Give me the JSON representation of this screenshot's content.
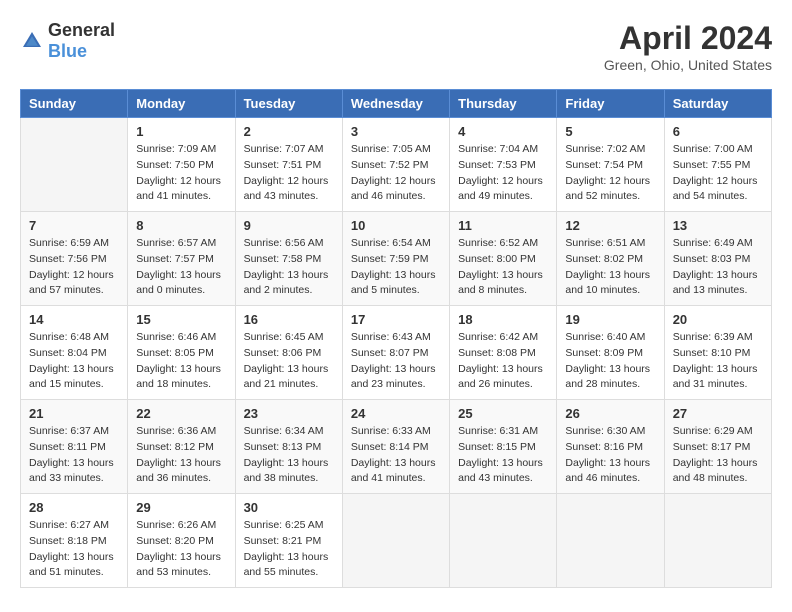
{
  "header": {
    "logo_general": "General",
    "logo_blue": "Blue",
    "title": "April 2024",
    "location": "Green, Ohio, United States"
  },
  "columns": [
    "Sunday",
    "Monday",
    "Tuesday",
    "Wednesday",
    "Thursday",
    "Friday",
    "Saturday"
  ],
  "weeks": [
    [
      {
        "day": "",
        "sunrise": "",
        "sunset": "",
        "daylight": ""
      },
      {
        "day": "1",
        "sunrise": "Sunrise: 7:09 AM",
        "sunset": "Sunset: 7:50 PM",
        "daylight": "Daylight: 12 hours and 41 minutes."
      },
      {
        "day": "2",
        "sunrise": "Sunrise: 7:07 AM",
        "sunset": "Sunset: 7:51 PM",
        "daylight": "Daylight: 12 hours and 43 minutes."
      },
      {
        "day": "3",
        "sunrise": "Sunrise: 7:05 AM",
        "sunset": "Sunset: 7:52 PM",
        "daylight": "Daylight: 12 hours and 46 minutes."
      },
      {
        "day": "4",
        "sunrise": "Sunrise: 7:04 AM",
        "sunset": "Sunset: 7:53 PM",
        "daylight": "Daylight: 12 hours and 49 minutes."
      },
      {
        "day": "5",
        "sunrise": "Sunrise: 7:02 AM",
        "sunset": "Sunset: 7:54 PM",
        "daylight": "Daylight: 12 hours and 52 minutes."
      },
      {
        "day": "6",
        "sunrise": "Sunrise: 7:00 AM",
        "sunset": "Sunset: 7:55 PM",
        "daylight": "Daylight: 12 hours and 54 minutes."
      }
    ],
    [
      {
        "day": "7",
        "sunrise": "Sunrise: 6:59 AM",
        "sunset": "Sunset: 7:56 PM",
        "daylight": "Daylight: 12 hours and 57 minutes."
      },
      {
        "day": "8",
        "sunrise": "Sunrise: 6:57 AM",
        "sunset": "Sunset: 7:57 PM",
        "daylight": "Daylight: 13 hours and 0 minutes."
      },
      {
        "day": "9",
        "sunrise": "Sunrise: 6:56 AM",
        "sunset": "Sunset: 7:58 PM",
        "daylight": "Daylight: 13 hours and 2 minutes."
      },
      {
        "day": "10",
        "sunrise": "Sunrise: 6:54 AM",
        "sunset": "Sunset: 7:59 PM",
        "daylight": "Daylight: 13 hours and 5 minutes."
      },
      {
        "day": "11",
        "sunrise": "Sunrise: 6:52 AM",
        "sunset": "Sunset: 8:00 PM",
        "daylight": "Daylight: 13 hours and 8 minutes."
      },
      {
        "day": "12",
        "sunrise": "Sunrise: 6:51 AM",
        "sunset": "Sunset: 8:02 PM",
        "daylight": "Daylight: 13 hours and 10 minutes."
      },
      {
        "day": "13",
        "sunrise": "Sunrise: 6:49 AM",
        "sunset": "Sunset: 8:03 PM",
        "daylight": "Daylight: 13 hours and 13 minutes."
      }
    ],
    [
      {
        "day": "14",
        "sunrise": "Sunrise: 6:48 AM",
        "sunset": "Sunset: 8:04 PM",
        "daylight": "Daylight: 13 hours and 15 minutes."
      },
      {
        "day": "15",
        "sunrise": "Sunrise: 6:46 AM",
        "sunset": "Sunset: 8:05 PM",
        "daylight": "Daylight: 13 hours and 18 minutes."
      },
      {
        "day": "16",
        "sunrise": "Sunrise: 6:45 AM",
        "sunset": "Sunset: 8:06 PM",
        "daylight": "Daylight: 13 hours and 21 minutes."
      },
      {
        "day": "17",
        "sunrise": "Sunrise: 6:43 AM",
        "sunset": "Sunset: 8:07 PM",
        "daylight": "Daylight: 13 hours and 23 minutes."
      },
      {
        "day": "18",
        "sunrise": "Sunrise: 6:42 AM",
        "sunset": "Sunset: 8:08 PM",
        "daylight": "Daylight: 13 hours and 26 minutes."
      },
      {
        "day": "19",
        "sunrise": "Sunrise: 6:40 AM",
        "sunset": "Sunset: 8:09 PM",
        "daylight": "Daylight: 13 hours and 28 minutes."
      },
      {
        "day": "20",
        "sunrise": "Sunrise: 6:39 AM",
        "sunset": "Sunset: 8:10 PM",
        "daylight": "Daylight: 13 hours and 31 minutes."
      }
    ],
    [
      {
        "day": "21",
        "sunrise": "Sunrise: 6:37 AM",
        "sunset": "Sunset: 8:11 PM",
        "daylight": "Daylight: 13 hours and 33 minutes."
      },
      {
        "day": "22",
        "sunrise": "Sunrise: 6:36 AM",
        "sunset": "Sunset: 8:12 PM",
        "daylight": "Daylight: 13 hours and 36 minutes."
      },
      {
        "day": "23",
        "sunrise": "Sunrise: 6:34 AM",
        "sunset": "Sunset: 8:13 PM",
        "daylight": "Daylight: 13 hours and 38 minutes."
      },
      {
        "day": "24",
        "sunrise": "Sunrise: 6:33 AM",
        "sunset": "Sunset: 8:14 PM",
        "daylight": "Daylight: 13 hours and 41 minutes."
      },
      {
        "day": "25",
        "sunrise": "Sunrise: 6:31 AM",
        "sunset": "Sunset: 8:15 PM",
        "daylight": "Daylight: 13 hours and 43 minutes."
      },
      {
        "day": "26",
        "sunrise": "Sunrise: 6:30 AM",
        "sunset": "Sunset: 8:16 PM",
        "daylight": "Daylight: 13 hours and 46 minutes."
      },
      {
        "day": "27",
        "sunrise": "Sunrise: 6:29 AM",
        "sunset": "Sunset: 8:17 PM",
        "daylight": "Daylight: 13 hours and 48 minutes."
      }
    ],
    [
      {
        "day": "28",
        "sunrise": "Sunrise: 6:27 AM",
        "sunset": "Sunset: 8:18 PM",
        "daylight": "Daylight: 13 hours and 51 minutes."
      },
      {
        "day": "29",
        "sunrise": "Sunrise: 6:26 AM",
        "sunset": "Sunset: 8:20 PM",
        "daylight": "Daylight: 13 hours and 53 minutes."
      },
      {
        "day": "30",
        "sunrise": "Sunrise: 6:25 AM",
        "sunset": "Sunset: 8:21 PM",
        "daylight": "Daylight: 13 hours and 55 minutes."
      },
      {
        "day": "",
        "sunrise": "",
        "sunset": "",
        "daylight": ""
      },
      {
        "day": "",
        "sunrise": "",
        "sunset": "",
        "daylight": ""
      },
      {
        "day": "",
        "sunrise": "",
        "sunset": "",
        "daylight": ""
      },
      {
        "day": "",
        "sunrise": "",
        "sunset": "",
        "daylight": ""
      }
    ]
  ]
}
